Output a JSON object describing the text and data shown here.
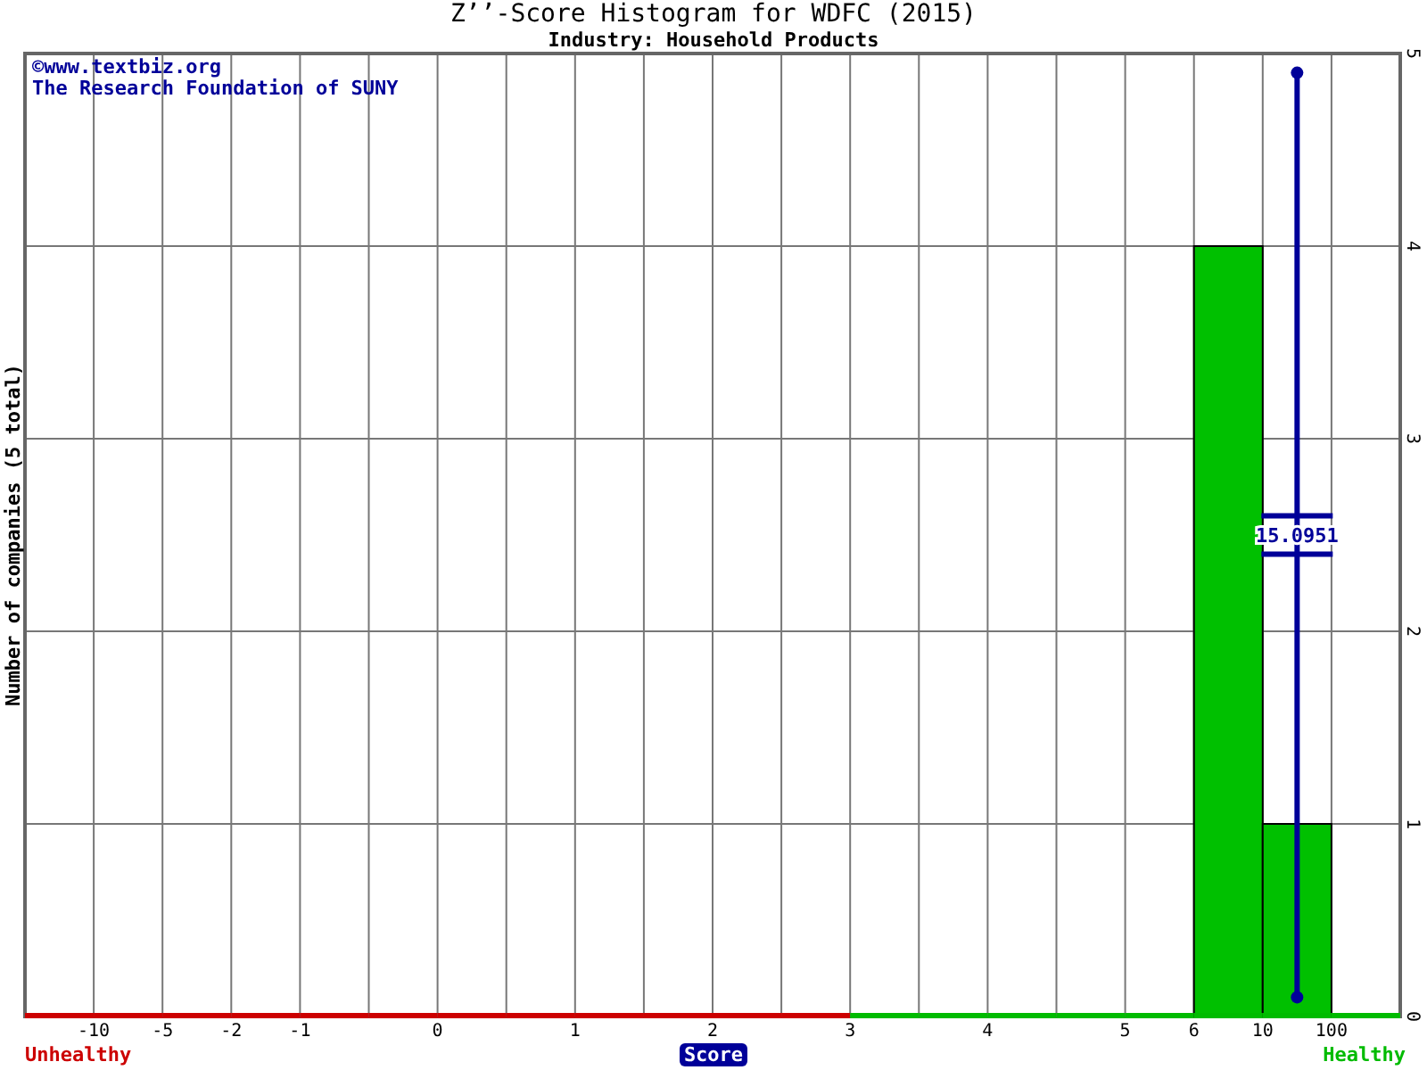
{
  "chart": {
    "title": "Z’’-Score Histogram for WDFC (2015)",
    "subtitle": "Industry: Household Products",
    "credits": [
      "©www.textbiz.org",
      "The Research Foundation of SUNY"
    ],
    "zone_labels": [
      {
        "kind": "unhealthy",
        "text": "Unhealthy",
        "color": "#cc0000"
      },
      {
        "kind": "healthy",
        "text": "Healthy",
        "color": "#00bb00"
      }
    ],
    "bins": [
      {
        "healthy": false
      },
      {
        "left_label": "-10",
        "healthy": false
      },
      {
        "left_label": "-5",
        "healthy": false
      },
      {
        "left_label": "-2",
        "healthy": false
      },
      {
        "left_label": "-1",
        "healthy": false
      },
      {
        "healthy": false
      },
      {
        "left_label": "0",
        "healthy": false
      },
      {
        "healthy": false
      },
      {
        "left_label": "1",
        "healthy": false
      },
      {
        "healthy": false
      },
      {
        "left_label": "2",
        "healthy": false
      },
      {
        "healthy": false
      },
      {
        "left_label": "3",
        "healthy": true
      },
      {
        "healthy": true
      },
      {
        "left_label": "4",
        "healthy": true
      },
      {
        "healthy": true
      },
      {
        "left_label": "5",
        "healthy": true
      },
      {
        "left_label": "6",
        "healthy": true
      },
      {
        "left_label": "10",
        "healthy": true,
        "marker": true
      },
      {
        "left_label": "100",
        "healthy": true
      }
    ],
    "chart_data": {
      "type": "bar",
      "xlabel": "Score",
      "ylabel": "Number of companies (5 total)",
      "grid": true,
      "categories": [
        null,
        null,
        null,
        null,
        null,
        null,
        null,
        null,
        null,
        null,
        null,
        null,
        null,
        null,
        null,
        null,
        null,
        null,
        null,
        null
      ],
      "values": [
        0,
        0,
        0,
        0,
        0,
        0,
        0,
        0,
        0,
        0,
        0,
        0,
        0,
        0,
        0,
        0,
        0,
        4,
        1,
        0
      ],
      "ylim": [
        0,
        5
      ],
      "yticks": [
        0,
        1,
        2,
        3,
        4,
        5
      ],
      "annotations": [
        "15.0951"
      ]
    }
  }
}
